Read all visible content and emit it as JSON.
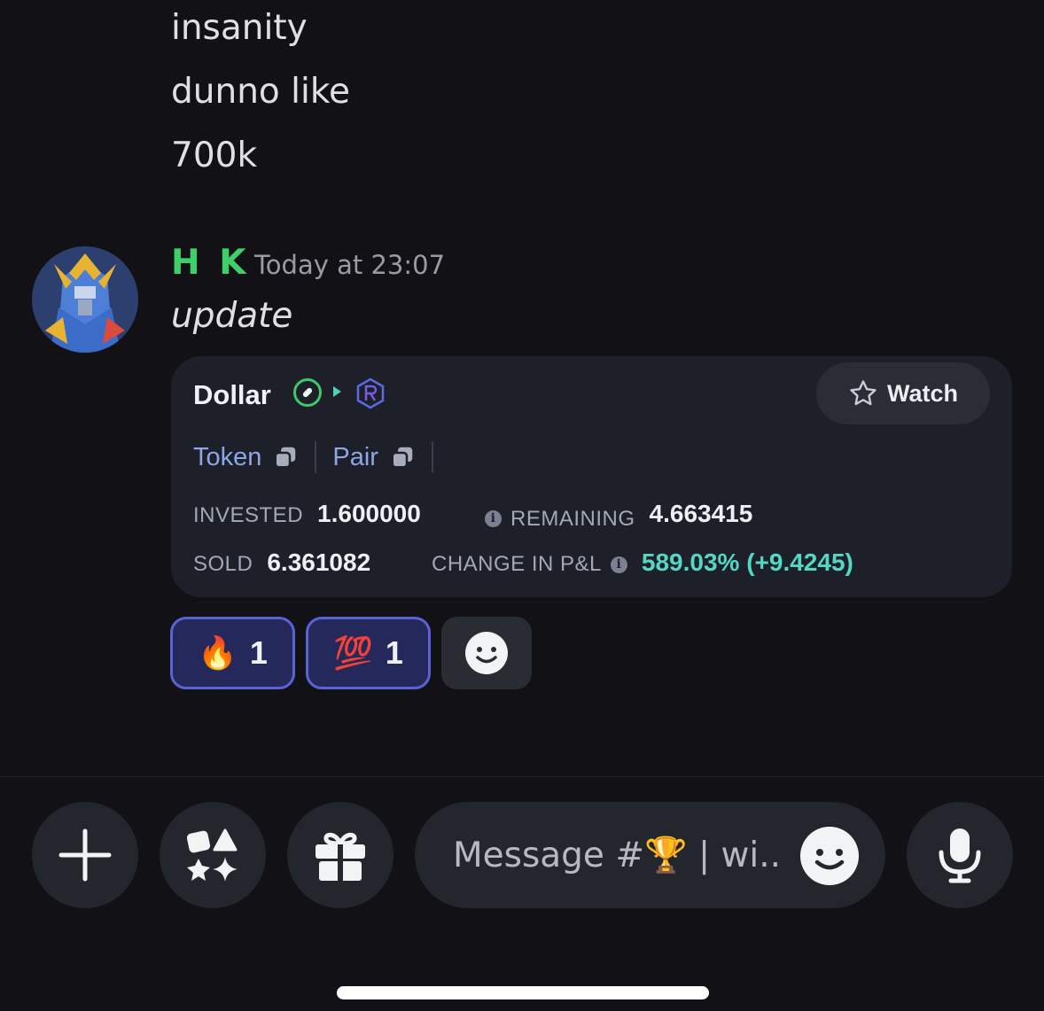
{
  "messages": {
    "previous_lines": [
      "insanity",
      "dunno like",
      "700k"
    ],
    "current": {
      "username": "H K",
      "timestamp": "Today at 23:07",
      "text": "update"
    }
  },
  "embed": {
    "token_name": "Dollar",
    "watch_label": "Watch",
    "links": {
      "token": "Token",
      "pair": "Pair"
    },
    "stats": {
      "invested_label": "INVESTED",
      "invested_value": "1.600000",
      "remaining_label": "REMAINING",
      "remaining_value": "4.663415",
      "sold_label": "SOLD",
      "sold_value": "6.361082",
      "change_label": "CHANGE IN P&L",
      "change_value": "589.03% (+9.4245)"
    }
  },
  "reactions": [
    {
      "emoji": "🔥",
      "count": "1"
    },
    {
      "emoji": "💯",
      "count": "1"
    }
  ],
  "composer": {
    "placeholder": "Message #🏆 | wi.."
  },
  "colors": {
    "background": "#121216",
    "username": "#3ecf6b",
    "link": "#8ea6e6",
    "positive": "#55d7c5",
    "reaction_active_border": "#5a63d6"
  }
}
